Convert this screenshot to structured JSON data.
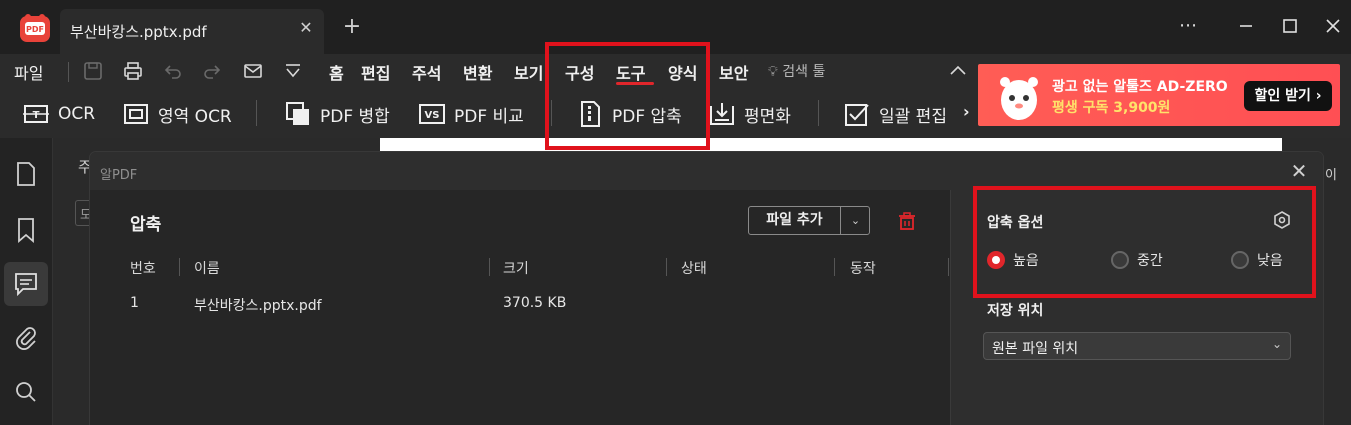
{
  "window": {
    "tab_title": "부산바캉스.pptx.pdf",
    "app_logo_text": "PDF"
  },
  "menu": {
    "file": "파일",
    "items": [
      "홈",
      "편집",
      "주석",
      "변환",
      "보기",
      "구성",
      "도구",
      "양식",
      "보안"
    ],
    "search_tool": "검색 툴"
  },
  "toolbar": {
    "tools": [
      "OCR",
      "영역 OCR",
      "PDF 병합",
      "PDF 비교",
      "PDF 압축",
      "평면화",
      "일괄 편집"
    ]
  },
  "ad": {
    "line1": "광고 없는 알툴즈 AD-ZERO",
    "line2": "평생 구독 3,900원",
    "button": "할인 받기 ›"
  },
  "background_panel": {
    "heading_fragment": "주",
    "field_fragment": "모",
    "right_fragment": "이"
  },
  "dialog": {
    "title": "알PDF",
    "section_title": "압축",
    "add_file_button": "파일 추가",
    "columns": [
      "번호",
      "이름",
      "크기",
      "상태",
      "동작"
    ],
    "rows": [
      {
        "no": "1",
        "name": "부산바캉스.pptx.pdf",
        "size": "370.5 KB",
        "status": "",
        "action": ""
      }
    ],
    "options": {
      "title": "압축 옵션",
      "levels": [
        "높음",
        "중간",
        "낮음"
      ],
      "selected": "높음",
      "save_location_label": "저장 위치",
      "save_location_value": "원본 파일 위치"
    }
  },
  "colors": {
    "accent_red": "#e0262b",
    "highlight_red": "#e0121c",
    "ad_bg": "#ff5a4e",
    "ad_subtext": "#ffe36a"
  }
}
